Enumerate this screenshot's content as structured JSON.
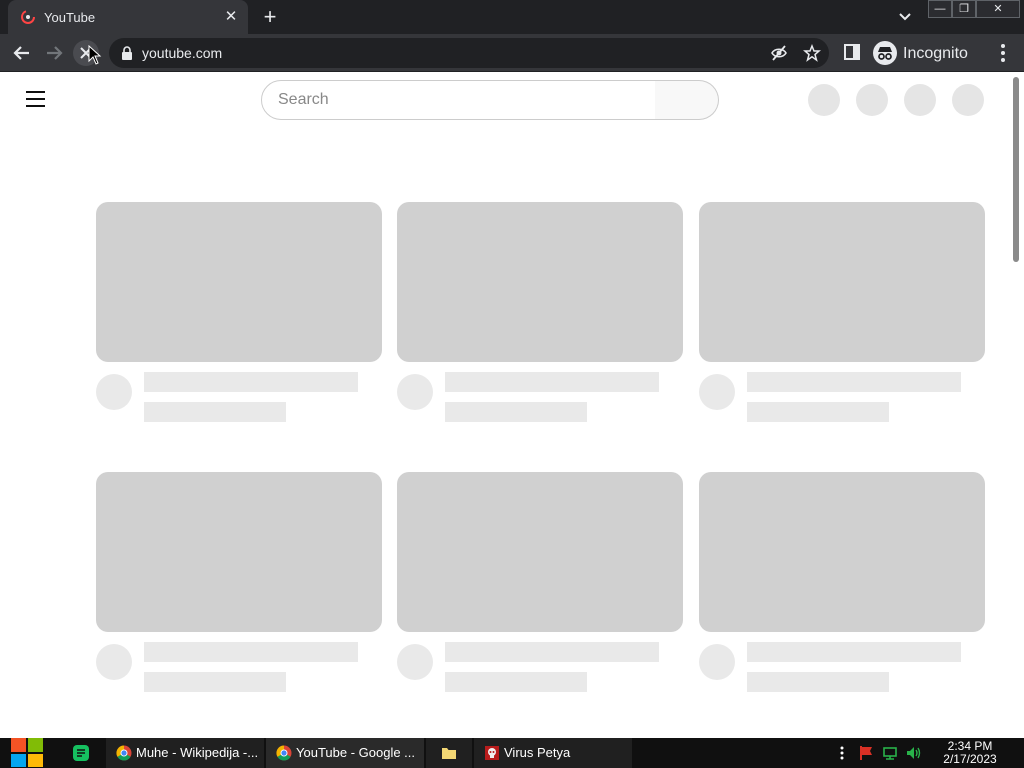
{
  "browser": {
    "tab_title": "YouTube",
    "tab_close": "✕",
    "new_tab": "+",
    "url": "youtube.com",
    "profile_label": "Incognito",
    "window_buttons": [
      "—",
      "❐",
      "✕"
    ]
  },
  "youtube": {
    "search_placeholder": "Search",
    "grid": {
      "rows": 2,
      "columns": 3,
      "state": "loading-skeleton"
    }
  },
  "taskbar": {
    "items": [
      {
        "label": "Muhe - Wikipedija -...",
        "icon": "chrome-icon"
      },
      {
        "label": "YouTube - Google ...",
        "icon": "chrome-icon"
      },
      {
        "label": "",
        "icon": "folder-icon"
      },
      {
        "label": "Virus Petya",
        "icon": "skull-icon"
      }
    ],
    "time": "2:34 PM",
    "date": "2/17/2023"
  },
  "colors": {
    "browser_dark": "#202124",
    "browser_chrome": "#35363a",
    "skeleton": "#d0d0d0",
    "skeleton_light": "#e9e9e9"
  }
}
